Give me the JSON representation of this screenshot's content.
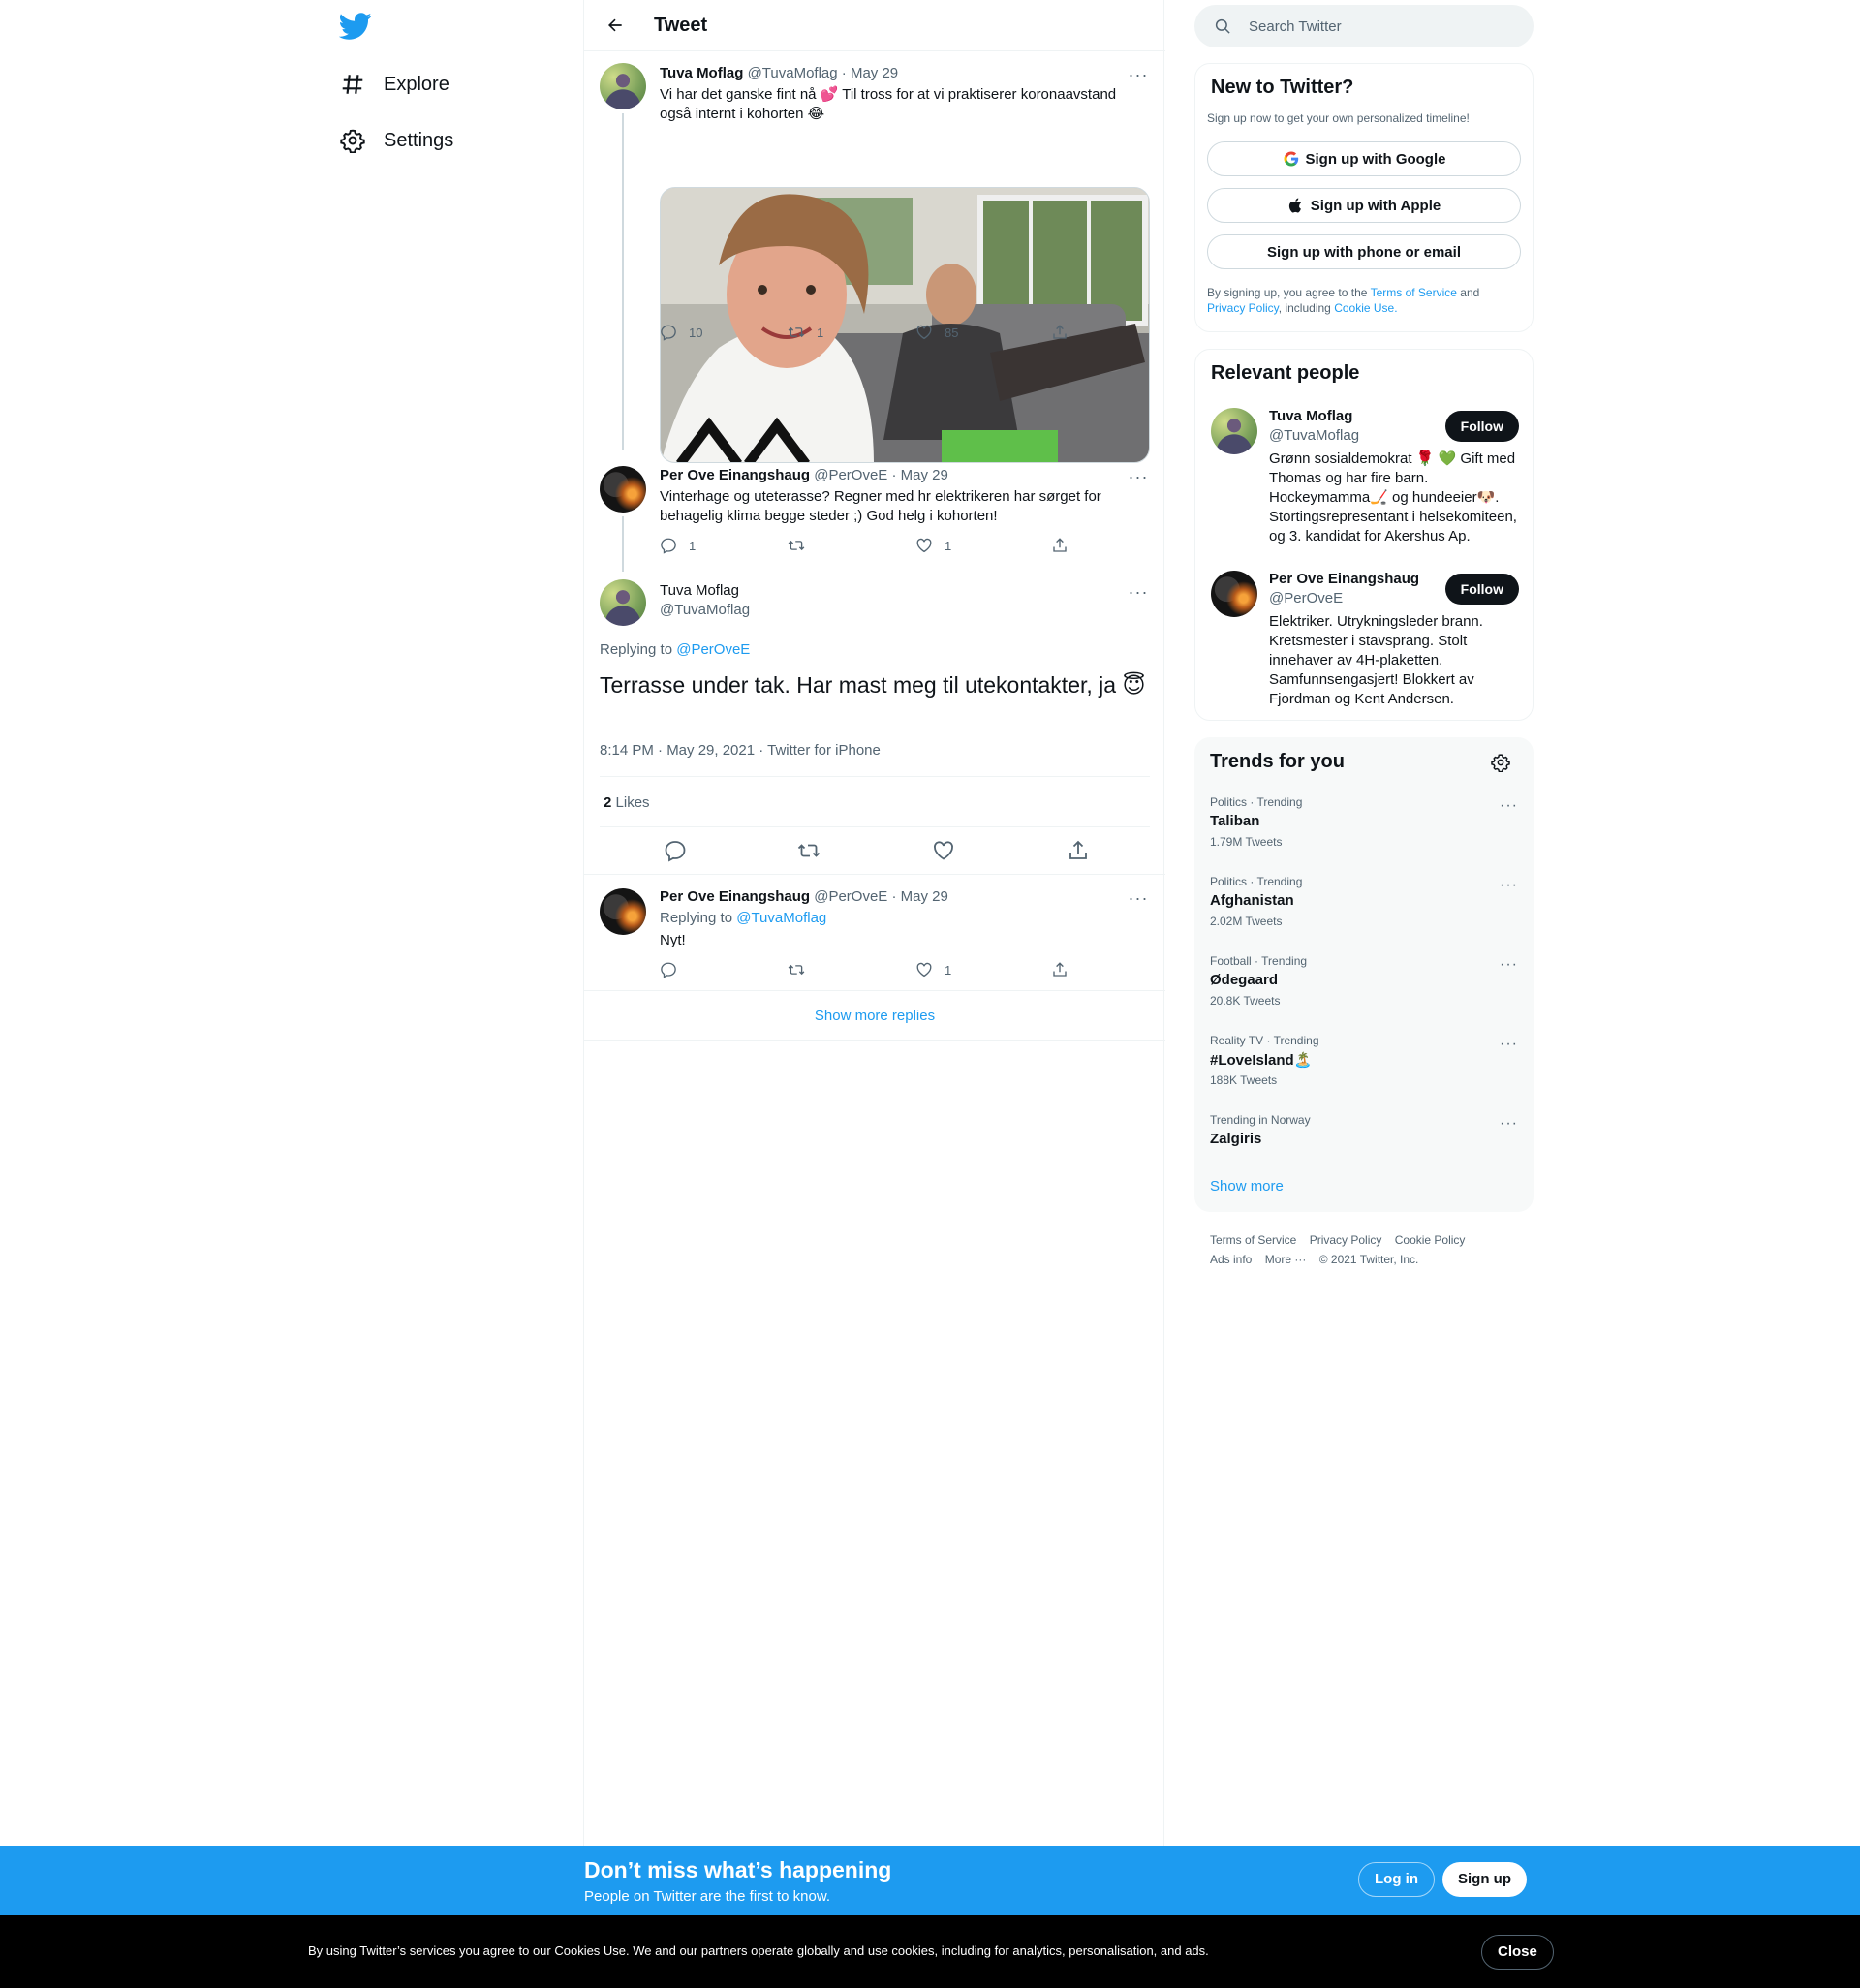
{
  "nav": {
    "logo_icon": "twitter-bird-icon",
    "items": [
      {
        "label": "Explore",
        "icon": "hashtag-icon"
      },
      {
        "label": "Settings",
        "icon": "gear-icon"
      }
    ]
  },
  "header": {
    "title": "Tweet"
  },
  "tweets": [
    {
      "name": "Tuva Moflag",
      "handle": "@TuvaMoflag",
      "date": "· May 29",
      "text": "Vi har det ganske fint nå 💕 Til tross for at vi praktiserer koronaavstand også internt i kohorten 😂",
      "replies": "10",
      "retweets": "1",
      "likes": "85"
    },
    {
      "name": "Per Ove Einangshaug",
      "handle": "@PerOveE",
      "date": "· May 29",
      "text": "Vinterhage og uteterasse? Regner med hr elektrikeren har sørget for behagelig klima begge steder ;) God helg i kohorten!",
      "replies": "1",
      "retweets": "",
      "likes": "1"
    }
  ],
  "focal": {
    "name": "Tuva Moflag",
    "handle": "@TuvaMoflag",
    "replying_prefix": "Replying to",
    "replying_to": "@PerOveE",
    "text": "Terrasse under tak. Har mast meg til utekontakter, ja 😇",
    "meta": "8:14 PM · May 29, 2021 · Twitter for iPhone",
    "likes_count": "2",
    "likes_label": "Likes"
  },
  "reply": {
    "name": "Per Ove Einangshaug",
    "handle": "@PerOveE",
    "date": "· May 29",
    "replying_prefix": "Replying to",
    "replying_to": "@TuvaMoflag",
    "text": "Nyt!",
    "replies": "",
    "retweets": "",
    "likes": "1"
  },
  "show_more_replies": "Show more replies",
  "search": {
    "placeholder": "Search Twitter"
  },
  "new_to_twitter": {
    "title": "New to Twitter?",
    "subtitle": "Sign up now to get your own personalized timeline!",
    "google": "Sign up with Google",
    "apple": "Sign up with Apple",
    "phone": "Sign up with phone or email",
    "terms_prefix": "By signing up, you agree to the",
    "terms_link": "Terms of Service",
    "and": "and",
    "privacy_link": "Privacy Policy",
    "including": ", including",
    "cookie_link": "Cookie Use."
  },
  "relevant_people": {
    "title": "Relevant people",
    "people": [
      {
        "name": "Tuva Moflag",
        "handle": "@TuvaMoflag",
        "follow": "Follow",
        "bio": "Grønn sosialdemokrat 🌹 💚 Gift med Thomas og har fire barn. Hockeymamma🏒 og hundeeier🐶. Stortingsrepresentant i helsekomiteen, og 3. kandidat for Akershus Ap."
      },
      {
        "name": "Per Ove Einangshaug",
        "handle": "@PerOveE",
        "follow": "Follow",
        "bio": "Elektriker. Utrykningsleder brann. Kretsmester i stavsprang. Stolt innehaver av 4H-plaketten. Samfunnsengasjert! Blokkert av Fjordman og Kent Andersen."
      }
    ]
  },
  "trends": {
    "title": "Trends for you",
    "items": [
      {
        "meta": "Politics · Trending",
        "name": "Taliban",
        "count": "1.79M Tweets"
      },
      {
        "meta": "Politics · Trending",
        "name": "Afghanistan",
        "count": "2.02M Tweets"
      },
      {
        "meta": "Football · Trending",
        "name": "Ødegaard",
        "count": "20.8K Tweets"
      },
      {
        "meta": "Reality TV · Trending",
        "name": "#LoveIsland🏝️",
        "count": "188K Tweets"
      },
      {
        "meta": "Trending in Norway",
        "name": "Zalgiris",
        "count": ""
      }
    ],
    "show_more": "Show more"
  },
  "footer": {
    "links": [
      "Terms of Service",
      "Privacy Policy",
      "Cookie Policy",
      "Ads info",
      "More ···",
      "© 2021 Twitter, Inc."
    ]
  },
  "banner": {
    "title": "Don’t miss what’s happening",
    "subtitle": "People on Twitter are the first to know.",
    "login": "Log in",
    "signup": "Sign up"
  },
  "cookie": {
    "text": "By using Twitter’s services you agree to our Cookies Use. We and our partners operate globally and use cookies, including for analytics, personalisation, and ads.",
    "close": "Close"
  },
  "colors": {
    "accent": "#1d9bf0",
    "text": "#0f1419",
    "muted": "#536471",
    "border": "#eff3f4"
  }
}
